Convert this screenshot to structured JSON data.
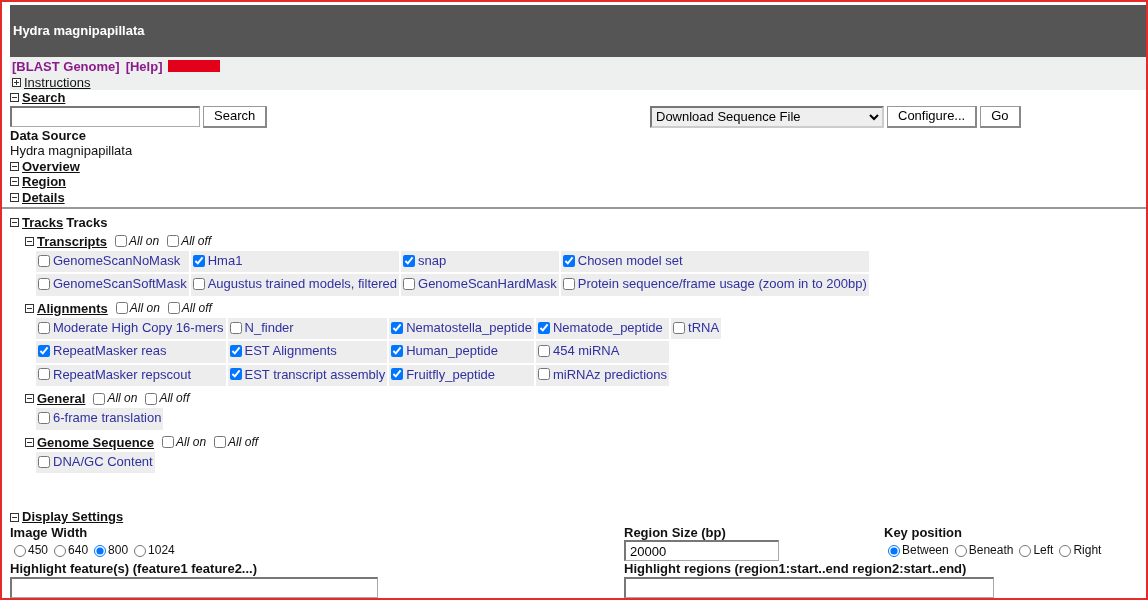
{
  "header": {
    "title": "Hydra magnipapillata"
  },
  "links": [
    {
      "kind": "link",
      "label": "[BLAST Genome]"
    },
    {
      "kind": "link",
      "label": "[Help]"
    },
    {
      "kind": "masked"
    }
  ],
  "instructions": {
    "label": "Instructions",
    "expanded": false
  },
  "search": {
    "label": "Search",
    "expanded": true,
    "button": "Search",
    "download": {
      "value": "Download Sequence File",
      "buttons": [
        "Configure...",
        "Go"
      ]
    }
  },
  "data_source": {
    "label": "Data Source",
    "value": "Hydra magnipapillata"
  },
  "sections": [
    {
      "label": "Overview",
      "expanded": true
    },
    {
      "label": "Region",
      "expanded": true
    },
    {
      "label": "Details",
      "expanded": true
    }
  ],
  "tracks": {
    "label": "Tracks",
    "suffix": "Tracks",
    "expanded": true,
    "groups": [
      {
        "label": "Transcripts",
        "expanded": true,
        "all_on": {
          "label": "All on",
          "checked": false
        },
        "all_off": {
          "label": "All off",
          "checked": false
        },
        "rows": [
          [
            {
              "label": "GenomeScanNoMask",
              "checked": false
            },
            {
              "label": "Hma1",
              "checked": true
            },
            {
              "label": "snap",
              "checked": true
            },
            {
              "label": "Chosen model set",
              "checked": true
            }
          ],
          [
            {
              "label": "GenomeScanSoftMask",
              "checked": false
            },
            {
              "label": "Augustus trained models, filtered",
              "checked": false
            },
            {
              "label": "GenomeScanHardMask",
              "checked": false
            },
            {
              "label": "Protein sequence/frame usage (zoom in to 200bp)",
              "checked": false
            }
          ]
        ]
      },
      {
        "label": "Alignments",
        "expanded": true,
        "all_on": {
          "label": "All on",
          "checked": false
        },
        "all_off": {
          "label": "All off",
          "checked": false
        },
        "rows": [
          [
            {
              "label": "Moderate High Copy 16-mers",
              "checked": false
            },
            {
              "label": "N_finder",
              "checked": false
            },
            {
              "label": "Nematostella_peptide",
              "checked": true
            },
            {
              "label": "Nematode_peptide",
              "checked": true
            },
            {
              "label": "tRNA",
              "checked": false
            }
          ],
          [
            {
              "label": "RepeatMasker reas",
              "checked": true
            },
            {
              "label": "EST Alignments",
              "checked": true
            },
            {
              "label": "Human_peptide",
              "checked": true
            },
            {
              "label": "454 miRNA",
              "checked": false
            }
          ],
          [
            {
              "label": "RepeatMasker repscout",
              "checked": false
            },
            {
              "label": "EST transcript assembly",
              "checked": true
            },
            {
              "label": "Fruitfly_peptide",
              "checked": true
            },
            {
              "label": "miRNAz predictions",
              "checked": false
            }
          ]
        ]
      },
      {
        "label": "General",
        "expanded": true,
        "all_on": {
          "label": "All on",
          "checked": false
        },
        "all_off": {
          "label": "All off",
          "checked": false
        },
        "rows": [
          [
            {
              "label": "6-frame translation",
              "checked": false
            }
          ]
        ]
      },
      {
        "label": "Genome Sequence",
        "expanded": true,
        "all_on": {
          "label": "All on",
          "checked": false
        },
        "all_off": {
          "label": "All off",
          "checked": false
        },
        "rows": [
          [
            {
              "label": "DNA/GC Content",
              "checked": false
            }
          ]
        ]
      }
    ]
  },
  "display_settings": {
    "label": "Display Settings",
    "expanded": true,
    "image_width": {
      "label": "Image Width",
      "options": [
        {
          "label": "450",
          "selected": false
        },
        {
          "label": "640",
          "selected": false
        },
        {
          "label": "800",
          "selected": true
        },
        {
          "label": "1024",
          "selected": false
        }
      ]
    },
    "region_size": {
      "label": "Region Size (bp)",
      "value": "20000"
    },
    "key_position": {
      "label": "Key position",
      "options": [
        {
          "label": "Between",
          "selected": true
        },
        {
          "label": "Beneath",
          "selected": false
        },
        {
          "label": "Left",
          "selected": false
        },
        {
          "label": "Right",
          "selected": false
        }
      ]
    },
    "highlight_features": {
      "label": "Highlight feature(s) (feature1 feature2...)"
    },
    "highlight_regions": {
      "label": "Highlight regions (region1:start..end region2:start..end)"
    }
  }
}
